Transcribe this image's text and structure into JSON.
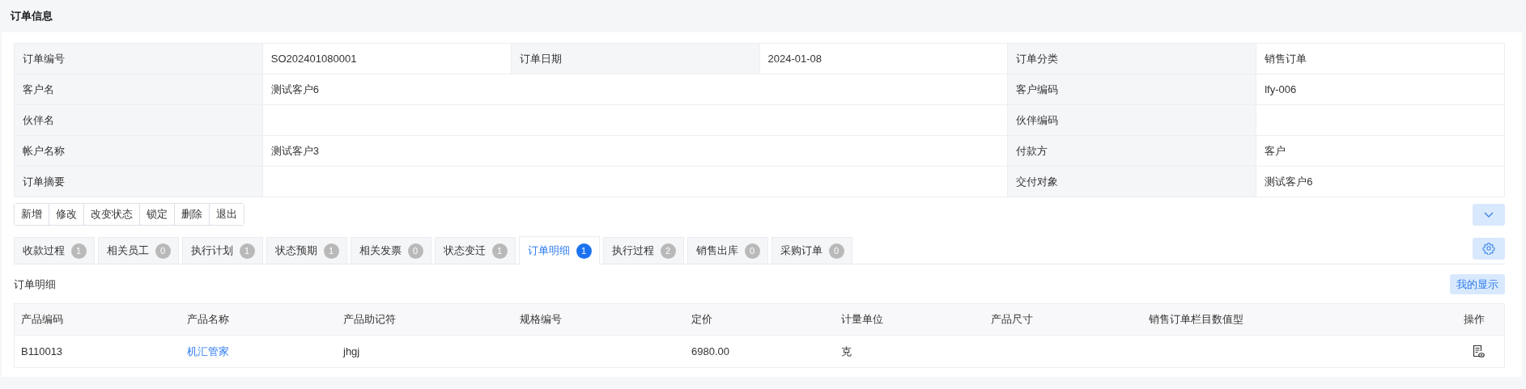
{
  "page_title": "订单信息",
  "info_rows": [
    {
      "pairs": [
        {
          "label": "订单编号",
          "value": "SO202401080001"
        },
        {
          "label": "订单日期",
          "value": "2024-01-08"
        },
        {
          "label": "订单分类",
          "value": "销售订单"
        }
      ]
    },
    {
      "pairs": [
        {
          "label": "客户名",
          "value": "测试客户6"
        },
        {
          "label": "客户编码",
          "value": "lfy-006"
        }
      ]
    },
    {
      "pairs": [
        {
          "label": "伙伴名"
        },
        {
          "label": "伙伴编码"
        }
      ]
    },
    {
      "pairs": [
        {
          "label": "帐户名称",
          "value": "测试客户3"
        },
        {
          "label": "付款方",
          "value": "客户"
        }
      ]
    },
    {
      "pairs": [
        {
          "label": "订单摘要"
        },
        {
          "label": "交付对象",
          "value": "测试客户6"
        }
      ]
    }
  ],
  "actions": [
    "新增",
    "修改",
    "改变状态",
    "锁定",
    "删除",
    "退出"
  ],
  "tabs": [
    {
      "label": "收款过程",
      "count": "1",
      "selected": false
    },
    {
      "label": "相关员工",
      "count": "0",
      "selected": false
    },
    {
      "label": "执行计划",
      "count": "1",
      "selected": false
    },
    {
      "label": "状态预期",
      "count": "1",
      "selected": false
    },
    {
      "label": "相关发票",
      "count": "0",
      "selected": false
    },
    {
      "label": "状态变迁",
      "count": "1",
      "selected": false
    },
    {
      "label": "订单明细",
      "count": "1",
      "selected": true
    },
    {
      "label": "执行过程",
      "count": "2",
      "selected": false
    },
    {
      "label": "销售出库",
      "count": "0",
      "selected": false
    },
    {
      "label": "采购订单",
      "count": "0",
      "selected": false
    }
  ],
  "section_title": "订单明细",
  "display_button": "我的显示",
  "table": {
    "columns": [
      "产品编码",
      "产品名称",
      "产品助记符",
      "规格编号",
      "定价",
      "计量单位",
      "产品尺寸",
      "销售订单栏目数值型",
      "操作"
    ],
    "rows": [
      {
        "cells": [
          {
            "text": "B110013",
            "kind": "text"
          },
          {
            "text": "机汇管家",
            "kind": "link"
          },
          {
            "text": "jhgj",
            "kind": "text"
          },
          {
            "kind": "empty"
          },
          {
            "text": "6980.00",
            "kind": "text"
          },
          {
            "text": "克",
            "kind": "text"
          },
          {
            "kind": "empty"
          },
          {
            "kind": "empty"
          },
          {
            "kind": "view_action"
          }
        ]
      }
    ]
  }
}
